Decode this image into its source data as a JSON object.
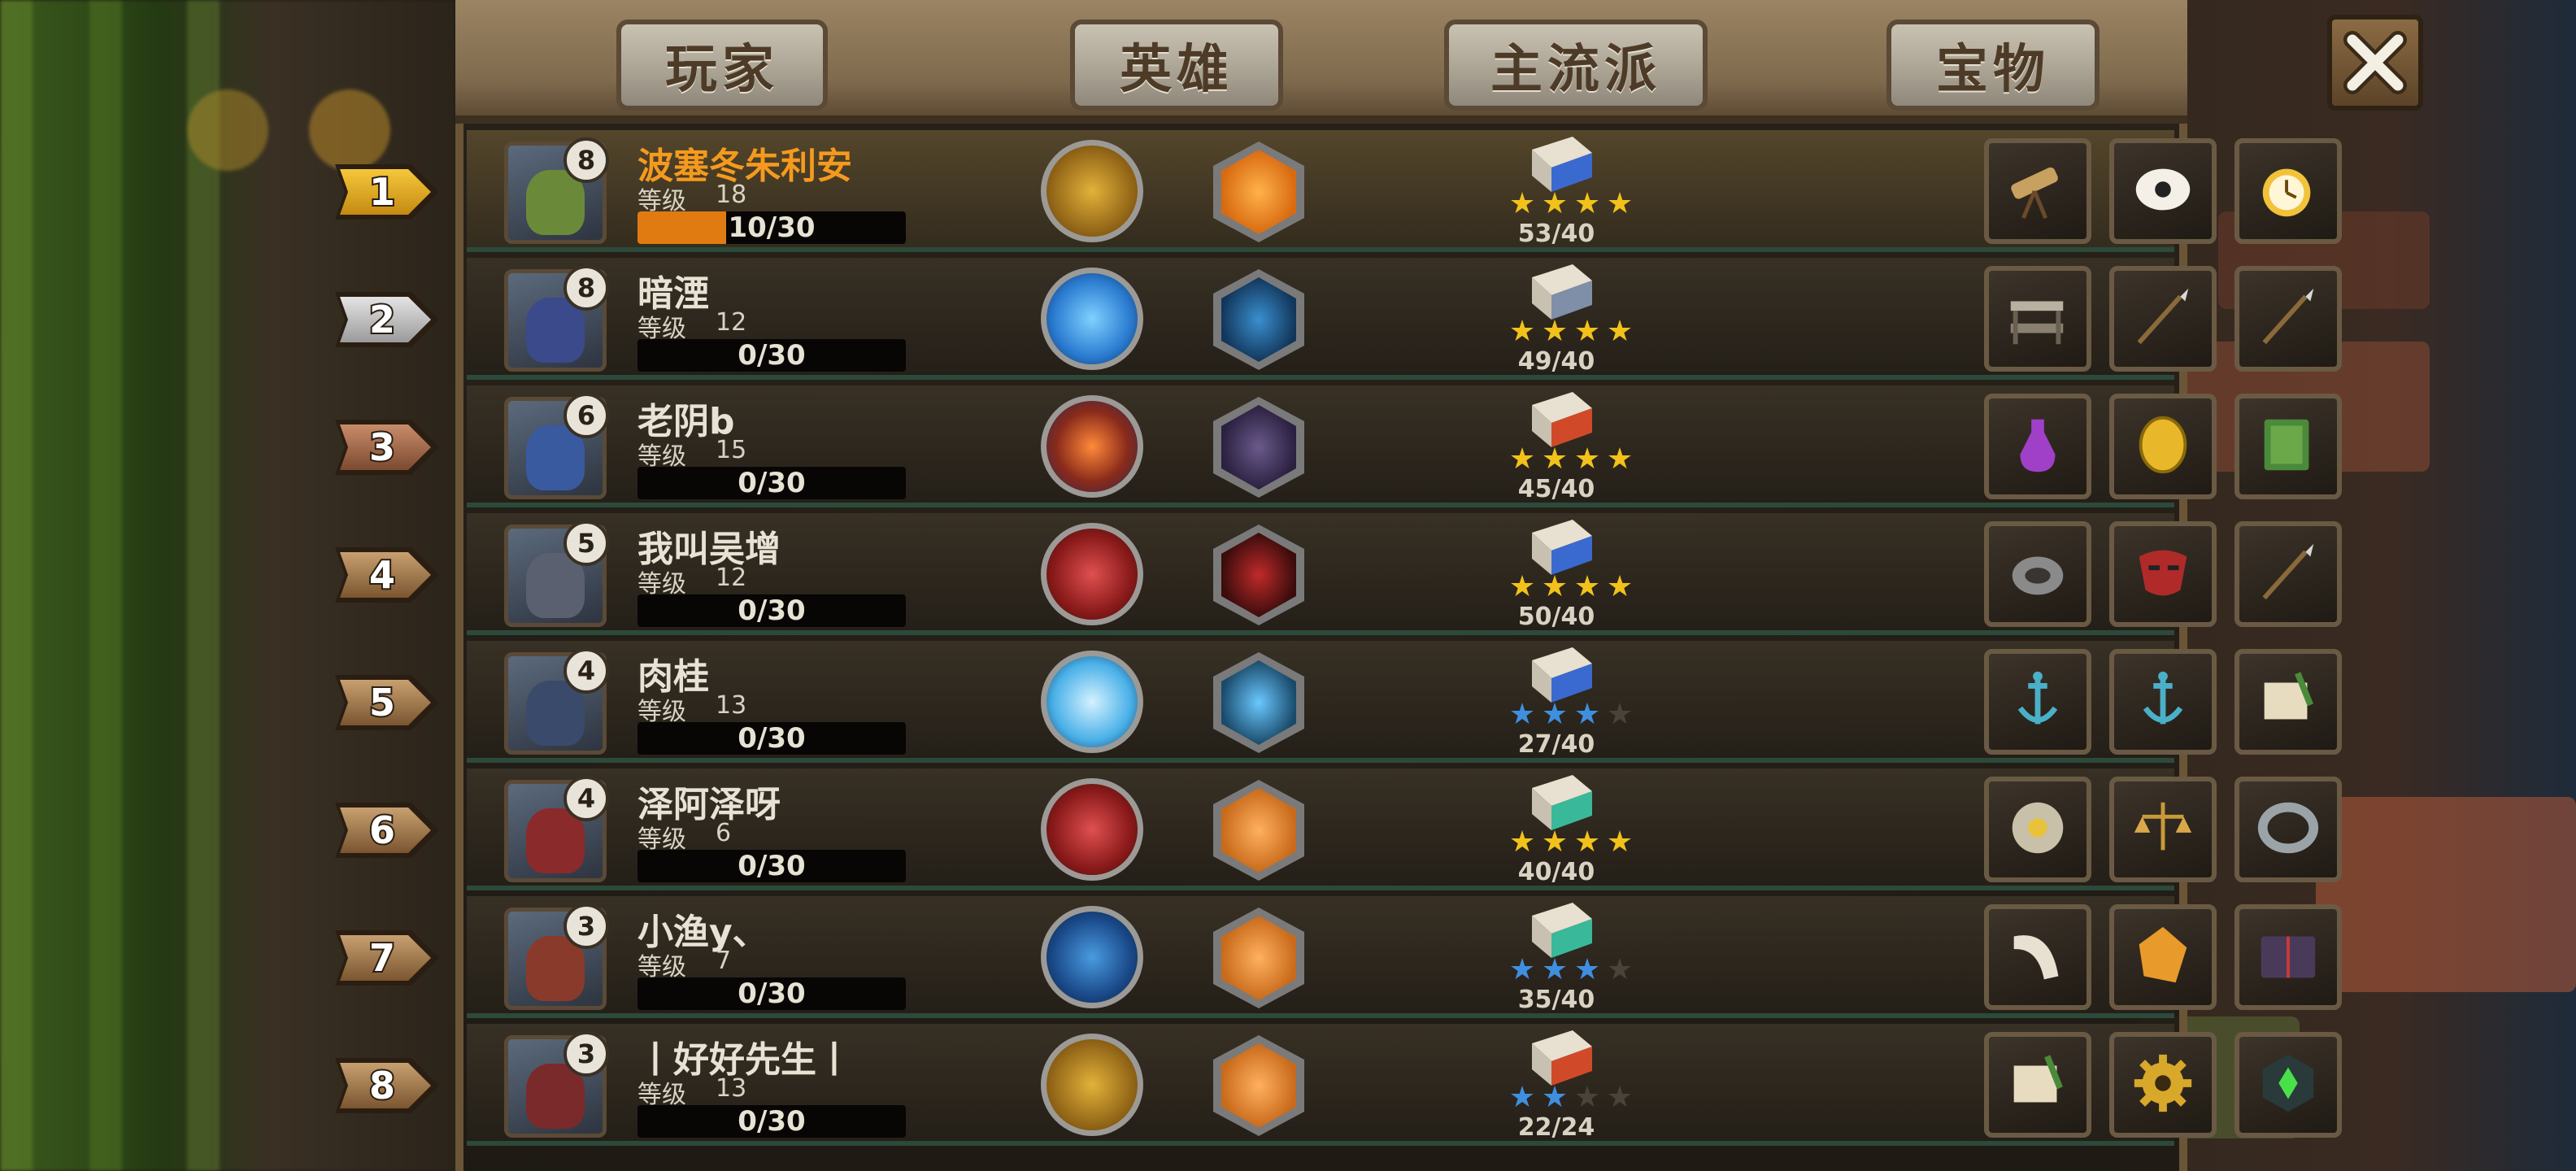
{
  "tabs": {
    "player": "玩家",
    "hero": "英雄",
    "build": "主流派",
    "treasure": "宝物"
  },
  "level_label": "等级",
  "colors": {
    "first_name": "#f59a1e",
    "name": "#e8e2d4",
    "bar_fill": "#e07b12",
    "star_gold": "#f2c21a",
    "star_blue": "#3f8fe0",
    "star_empty": "#4a4438"
  },
  "rows": [
    {
      "rank": "1",
      "name": "波塞冬朱利安",
      "badge": "8",
      "level": "18",
      "progress": "10/30",
      "progress_fraction": 0.33,
      "build_score": "53/40",
      "stars": [
        "gold",
        "gold",
        "gold",
        "gold"
      ],
      "hero_icons": [
        "gold-coins-icon",
        "gold-star-hexagon-icon"
      ],
      "items": [
        "telescope-icon",
        "magic-glove-icon",
        "pocket-watch-icon"
      ]
    },
    {
      "rank": "2",
      "name": "暗湮",
      "badge": "8",
      "level": "12",
      "progress": "0/30",
      "progress_fraction": 0,
      "build_score": "49/40",
      "stars": [
        "gold",
        "gold",
        "gold",
        "gold"
      ],
      "hero_icons": [
        "blue-water-icon",
        "blue-swirl-hexagon-icon"
      ],
      "items": [
        "bench-icon",
        "spear-icon",
        "spear-icon"
      ]
    },
    {
      "rank": "3",
      "name": "老阴b",
      "badge": "6",
      "level": "15",
      "progress": "0/30",
      "progress_fraction": 0,
      "build_score": "45/40",
      "stars": [
        "gold",
        "gold",
        "gold",
        "gold"
      ],
      "hero_icons": [
        "flame-fist-icon",
        "tornado-hexagon-icon"
      ],
      "items": [
        "potion-icon",
        "gold-coin-icon",
        "green-book-icon"
      ]
    },
    {
      "rank": "4",
      "name": "我叫吴增",
      "badge": "5",
      "level": "12",
      "progress": "0/30",
      "progress_fraction": 0,
      "build_score": "50/40",
      "stars": [
        "gold",
        "gold",
        "gold",
        "gold"
      ],
      "hero_icons": [
        "red-axe-icon",
        "demon-hexagon-icon"
      ],
      "items": [
        "stone-ring-icon",
        "red-mask-icon",
        "spear-icon"
      ]
    },
    {
      "rank": "5",
      "name": "肉桂",
      "badge": "4",
      "level": "13",
      "progress": "0/30",
      "progress_fraction": 0,
      "build_score": "27/40",
      "stars": [
        "blue",
        "blue",
        "blue",
        "empty"
      ],
      "hero_icons": [
        "ice-heart-icon",
        "ice-egg-hexagon-icon"
      ],
      "items": [
        "anchor-icon",
        "anchor-icon",
        "scroll-quill-icon"
      ]
    },
    {
      "rank": "6",
      "name": "泽阿泽呀",
      "badge": "4",
      "level": "6",
      "progress": "0/30",
      "progress_fraction": 0,
      "build_score": "40/40",
      "stars": [
        "gold",
        "gold",
        "gold",
        "gold"
      ],
      "hero_icons": [
        "red-axe-icon",
        "orange-rays-hexagon-icon"
      ],
      "items": [
        "compass-plate-icon",
        "balance-scale-icon",
        "iron-ring-icon"
      ]
    },
    {
      "rank": "7",
      "name": "小渔y、",
      "badge": "3",
      "level": "7",
      "progress": "0/30",
      "progress_fraction": 0,
      "build_score": "35/40",
      "stars": [
        "blue",
        "blue",
        "blue",
        "empty"
      ],
      "hero_icons": [
        "blue-star-icon",
        "orange-rays-hexagon-icon"
      ],
      "items": [
        "horn-icon",
        "amber-crystal-icon",
        "dark-book-icon"
      ]
    },
    {
      "rank": "8",
      "name": "丨好好先生丨",
      "badge": "3",
      "level": "13",
      "progress": "0/30",
      "progress_fraction": 0,
      "build_score": "22/24",
      "stars": [
        "blue",
        "blue",
        "empty",
        "empty"
      ],
      "hero_icons": [
        "gold-coins-icon",
        "orange-rays-hexagon-icon"
      ],
      "items": [
        "scroll-quill-icon",
        "gear-icon",
        "green-gem-cube-icon"
      ]
    }
  ]
}
